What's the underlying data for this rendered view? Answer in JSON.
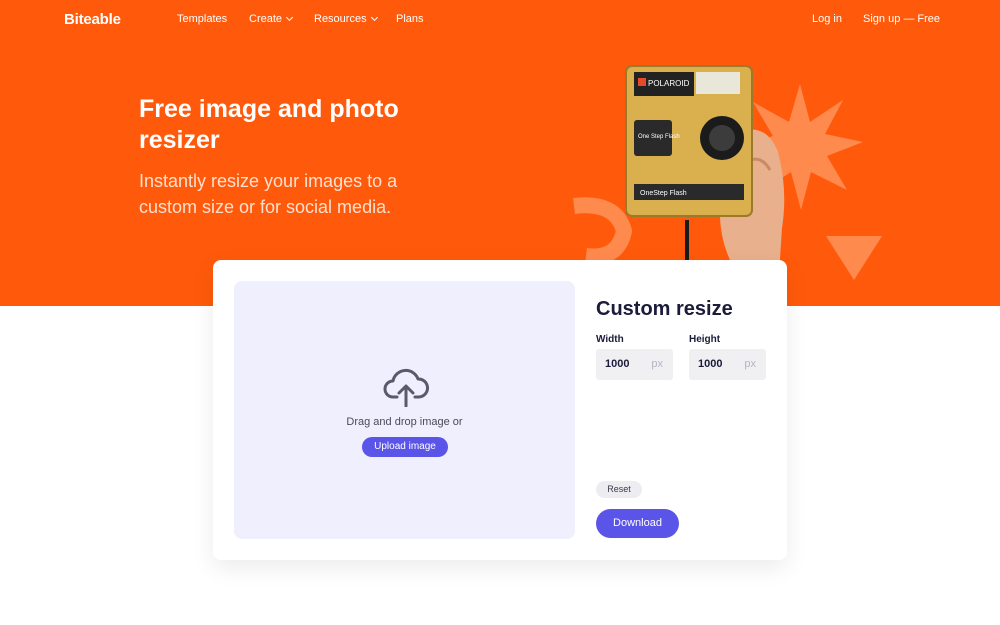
{
  "nav": {
    "logo": "Biteable",
    "items": [
      {
        "label": "Templates"
      },
      {
        "label": "Create"
      },
      {
        "label": "Resources"
      },
      {
        "label": "Plans"
      }
    ],
    "login": "Log in",
    "signup": "Sign up — Free"
  },
  "hero": {
    "title": "Free image and photo resizer",
    "subtitle": "Instantly resize your images to a custom size or for social media."
  },
  "upload": {
    "prompt": "Drag and drop image or",
    "button": "Upload image"
  },
  "resize": {
    "title": "Custom resize",
    "width_label": "Width",
    "height_label": "Height",
    "width_value": "1000",
    "height_value": "1000",
    "unit": "px",
    "reset": "Reset",
    "download": "Download"
  },
  "camera": {
    "brand": "POLAROID",
    "model": "One Step Flash",
    "model_bottom": "OneStep Flash"
  },
  "colors": {
    "brand_orange": "#ff5a0b",
    "accent_purple": "#5b54e8",
    "dropzone_bg": "#efeffd"
  }
}
